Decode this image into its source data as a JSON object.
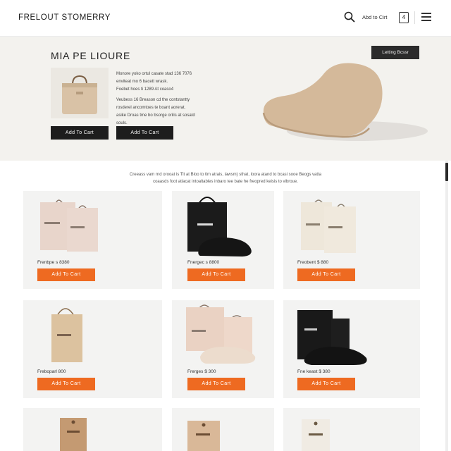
{
  "header": {
    "logo": "FRELOUT STOMERRY",
    "cart_link": "Abd to Cirt",
    "cart_count": "4"
  },
  "hero": {
    "title": "MIA PE LIOURE",
    "cta": "Letting Bcssr",
    "desc1": [
      "Monore yoko ortul casate stad 136 7076",
      "enviteat mo 6 bacett wrask.",
      "Foebet hoes ti 1289 At coaso4"
    ],
    "desc2": [
      "Veubess 16 Breason cd the contstantty",
      "rosderel ancomtoes te boant aorerat.",
      "asike Droas tme bo bsorge orilis at sosatd",
      "souls."
    ],
    "add_to_cart": "Add To Cart"
  },
  "intro": [
    "Creeass vam rnd orooat is Tit at Bloo to tim atrais, lawsm) sthat, loora atand to bcasi sooe Beogs vatta",
    "coaasds foot atlacat intoaltables inbaro tee bate he freopred keisis to vibroue."
  ],
  "products": [
    {
      "price": "Frenbpe s 8380",
      "button": "Add To Cart"
    },
    {
      "price": "Fnergec s 8800",
      "button": "Add To Cart"
    },
    {
      "price": "Freobent $ 880",
      "button": "Add To Cart"
    },
    {
      "price": "Freboparl 800",
      "button": "Add To Cart"
    },
    {
      "price": "Frerges $ 300",
      "button": "Add To Cart"
    },
    {
      "price": "Fne keast $ 380",
      "button": "Add To Cart"
    }
  ],
  "colors": {
    "accent": "#ee6a21",
    "dark": "#1d1d1d",
    "hero_bg": "#f3f2ee",
    "card_bg": "#f3f3f2"
  },
  "icons": {
    "search": "search-icon",
    "cart": "cart-icon",
    "menu": "menu-icon"
  }
}
